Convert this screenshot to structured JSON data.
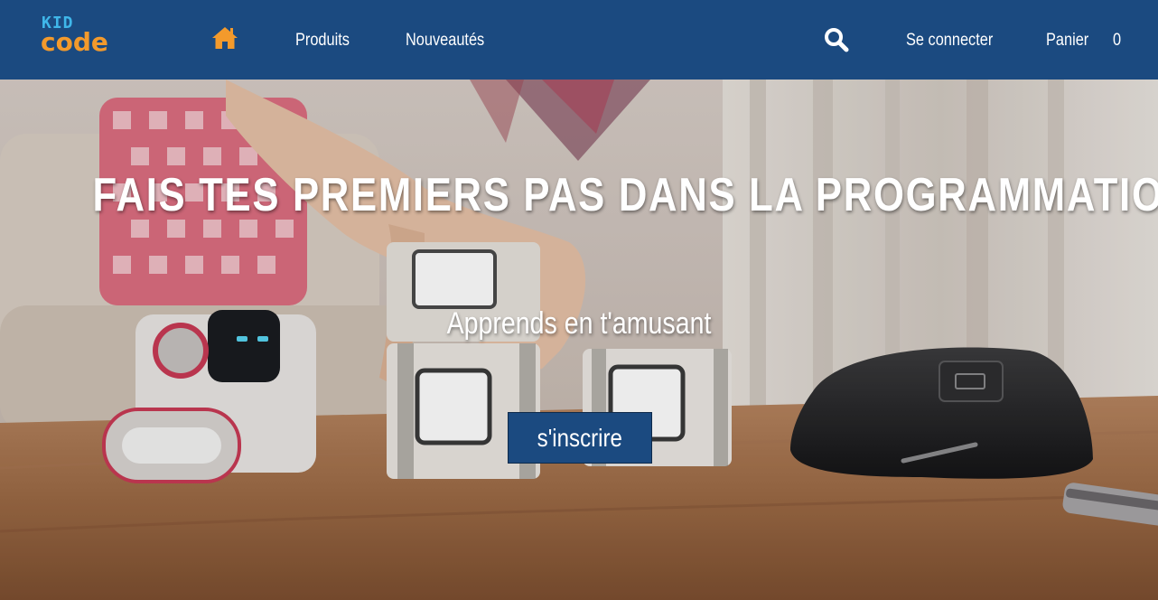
{
  "logo": {
    "line1": "KID",
    "line2": "code"
  },
  "nav": {
    "home_icon": "home-icon",
    "products": "Produits",
    "new": "Nouveautés",
    "search_icon": "search-icon",
    "login": "Se connecter",
    "cart_label": "Panier",
    "cart_count": "0"
  },
  "hero": {
    "title": "FAIS TES PREMIERS PAS DANS LA PROGRAMMATION !",
    "subtitle": "Apprends en t'amusant",
    "cta": "s'inscrire"
  },
  "colors": {
    "navbar": "#1b4a80",
    "accent": "#f39a2c",
    "logo_kid": "#3fb7ea",
    "button": "#1b4a80"
  }
}
